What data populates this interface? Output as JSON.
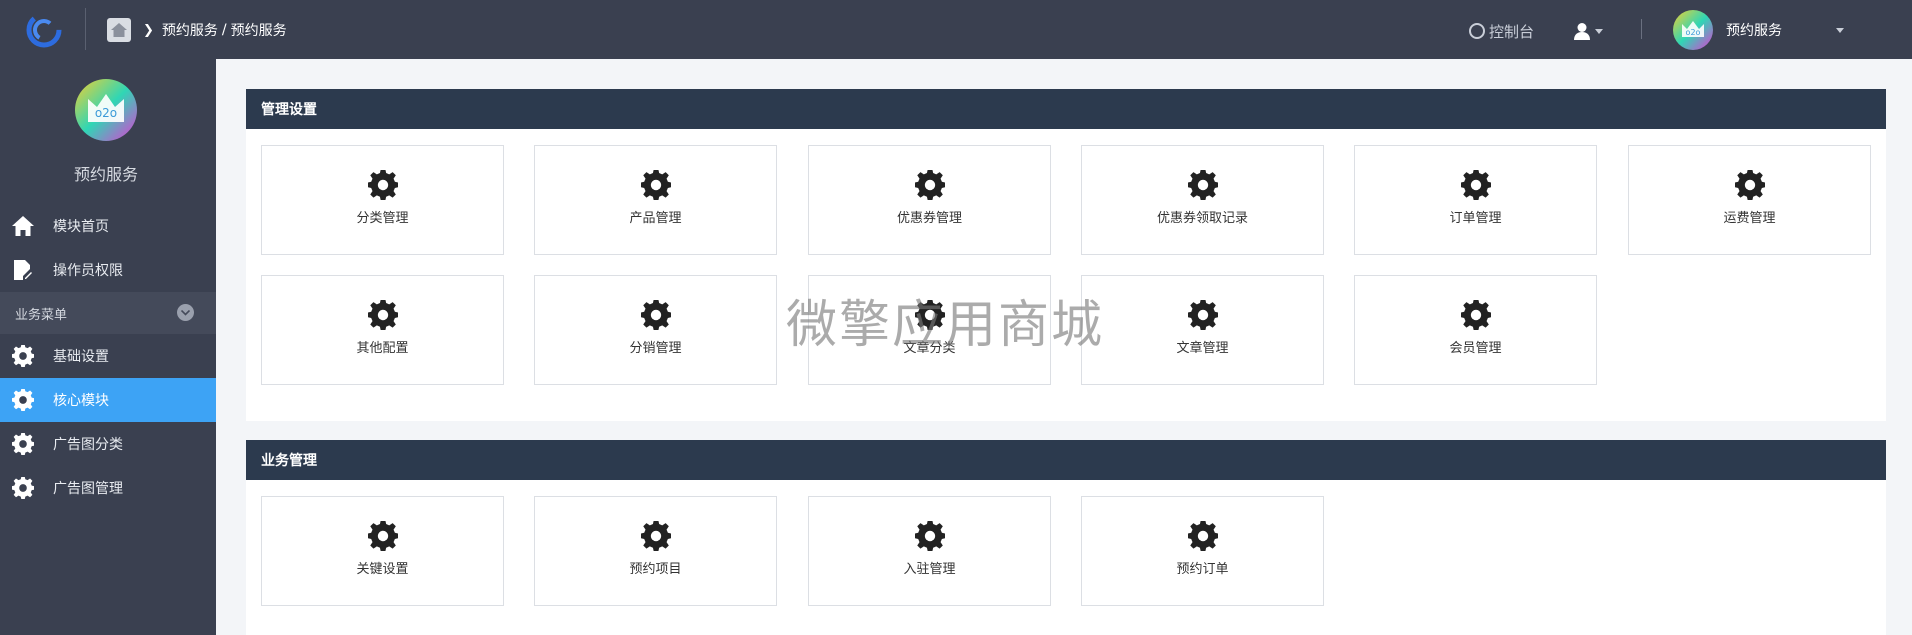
{
  "header": {
    "breadcrumb": {
      "section": "预约服务",
      "page": "预约服务",
      "separator": "/"
    },
    "console_label": "控制台",
    "user_name": "预约服务",
    "avatar_text": "o2o"
  },
  "sidebar": {
    "title": "预约服务",
    "avatar_text": "o2o",
    "top_items": [
      {
        "label": "模块首页",
        "icon": "home-icon"
      },
      {
        "label": "操作员权限",
        "icon": "document-edit-icon"
      }
    ],
    "section_label": "业务菜单",
    "menu_items": [
      {
        "label": "基础设置",
        "icon": "gear-icon"
      },
      {
        "label": "核心模块",
        "icon": "gear-icon",
        "active": true
      },
      {
        "label": "广告图分类",
        "icon": "gear-icon"
      },
      {
        "label": "广告图管理",
        "icon": "gear-icon"
      }
    ]
  },
  "panels": [
    {
      "title": "管理设置",
      "tiles": [
        "分类管理",
        "产品管理",
        "优惠券管理",
        "优惠券领取记录",
        "订单管理",
        "运费管理",
        "其他配置",
        "分销管理",
        "文章分类",
        "文章管理",
        "会员管理"
      ]
    },
    {
      "title": "业务管理",
      "tiles": [
        "关键设置",
        "预约项目",
        "入驻管理",
        "预约订单"
      ]
    }
  ],
  "watermark": "微擎应用商城",
  "colors": {
    "topbar": "#3a4050",
    "active": "#3da3f5",
    "panel_header": "#2c3a4e"
  }
}
